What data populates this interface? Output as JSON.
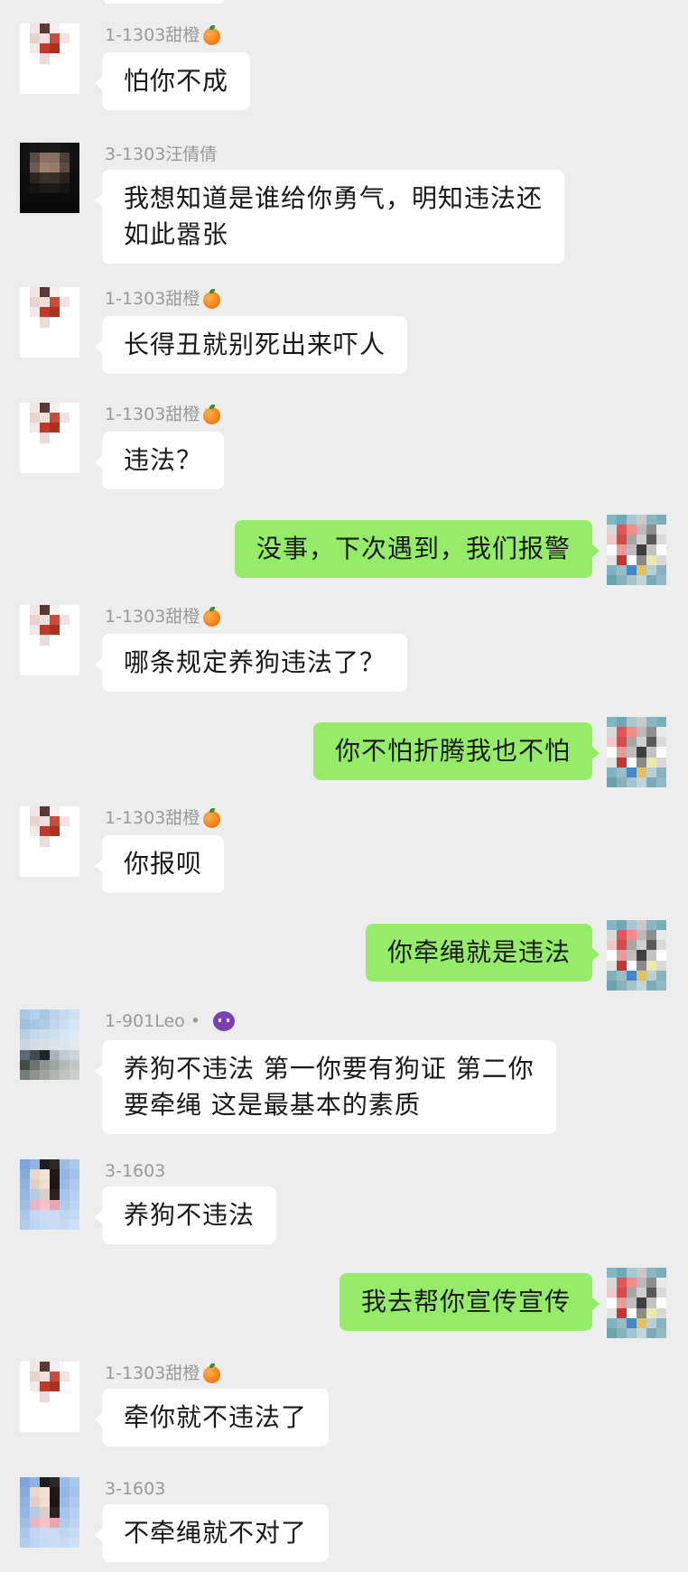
{
  "app": {
    "type": "group-chat",
    "colors": {
      "background": "#ededed",
      "incoming_bubble": "#ffffff",
      "outgoing_bubble": "#95ec69",
      "sender_name": "#9a9a9a",
      "text": "#191919"
    }
  },
  "messages": [
    {
      "side": "left",
      "sender": "1-1303甜橙",
      "sender_icon": "orange-icon",
      "avatar_palette": "a",
      "lines": [
        "怕你不成"
      ]
    },
    {
      "side": "left",
      "sender": "3-1303汪倩倩",
      "sender_icon": "",
      "avatar_palette": "b",
      "lines": [
        "我想知道是谁给你勇气，明知违法还",
        "如此嚣张"
      ]
    },
    {
      "side": "left",
      "sender": "1-1303甜橙",
      "sender_icon": "orange-icon",
      "avatar_palette": "a",
      "lines": [
        "长得丑就别死出来吓人"
      ]
    },
    {
      "side": "left",
      "sender": "1-1303甜橙",
      "sender_icon": "orange-icon",
      "avatar_palette": "a",
      "lines": [
        "违法？"
      ]
    },
    {
      "side": "right",
      "sender": "",
      "sender_icon": "",
      "avatar_palette": "self",
      "lines": [
        "没事，下次遇到，我们报警"
      ]
    },
    {
      "side": "left",
      "sender": "1-1303甜橙",
      "sender_icon": "orange-icon",
      "avatar_palette": "a",
      "lines": [
        "哪条规定养狗违法了？"
      ]
    },
    {
      "side": "right",
      "sender": "",
      "sender_icon": "",
      "avatar_palette": "self",
      "lines": [
        "你不怕折腾我也不怕"
      ]
    },
    {
      "side": "left",
      "sender": "1-1303甜橙",
      "sender_icon": "orange-icon",
      "avatar_palette": "a",
      "lines": [
        "你报呗"
      ]
    },
    {
      "side": "right",
      "sender": "",
      "sender_icon": "",
      "avatar_palette": "self",
      "lines": [
        "你牵绳就是违法"
      ]
    },
    {
      "side": "left",
      "sender": "1-901Leo •",
      "sender_icon": "devil-icon",
      "avatar_palette": "c",
      "lines": [
        "养狗不违法 第一你要有狗证 第二你",
        "要牵绳 这是最基本的素质"
      ]
    },
    {
      "side": "left",
      "sender": "3-1603",
      "sender_icon": "",
      "avatar_palette": "d",
      "lines": [
        "养狗不违法"
      ]
    },
    {
      "side": "right",
      "sender": "",
      "sender_icon": "",
      "avatar_palette": "self",
      "lines": [
        "我去帮你宣传宣传"
      ]
    },
    {
      "side": "left",
      "sender": "1-1303甜橙",
      "sender_icon": "orange-icon",
      "avatar_palette": "a",
      "lines": [
        "牵你就不违法了"
      ]
    },
    {
      "side": "left",
      "sender": "3-1603",
      "sender_icon": "",
      "avatar_palette": "d",
      "lines": [
        "不牵绳就不对了"
      ]
    }
  ]
}
